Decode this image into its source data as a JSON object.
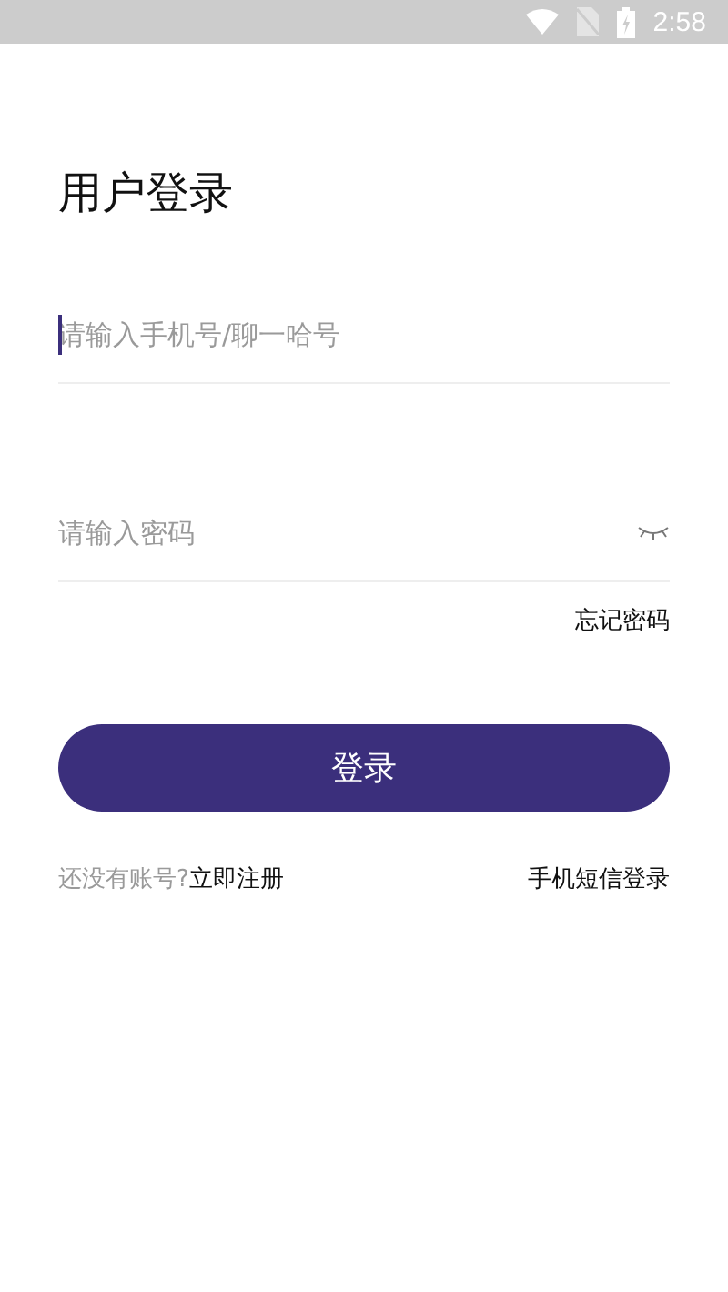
{
  "status_bar": {
    "time": "2:58"
  },
  "title": "用户登录",
  "fields": [
    {
      "kind": "text",
      "placeholder": "请输入手机号/聊一哈号",
      "focused": true
    },
    {
      "kind": "password",
      "placeholder": "请输入密码",
      "focused": false
    }
  ],
  "forgot_link": "忘记密码",
  "login_button": "登录",
  "register": {
    "prompt": "还没有账号?",
    "link": "立即注册"
  },
  "sms_login_link": "手机短信登录"
}
